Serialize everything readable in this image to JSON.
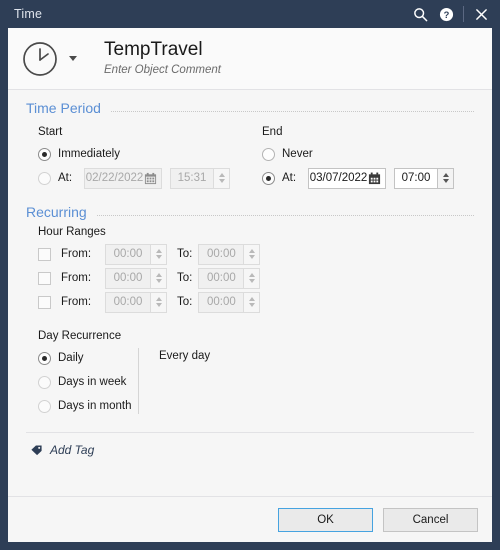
{
  "titlebar": {
    "title": "Time",
    "search_icon": "search-icon",
    "help_icon": "help-icon",
    "close_icon": "close-icon"
  },
  "object_header": {
    "icon": "clock-icon",
    "dropdown_icon": "chevron-down-icon",
    "title": "TempTravel",
    "subtitle": "Enter Object Comment"
  },
  "time_period": {
    "section_title": "Time Period",
    "start": {
      "label": "Start",
      "immediately_label": "Immediately",
      "immediately_selected": true,
      "at_label": "At:",
      "at_selected": false,
      "date_value": "02/22/2022",
      "time_value": "15:31",
      "calendar_icon": "calendar-icon",
      "enabled": false
    },
    "end": {
      "label": "End",
      "never_label": "Never",
      "never_selected": false,
      "at_label": "At:",
      "at_selected": true,
      "date_value": "03/07/2022",
      "time_value": "07:00",
      "calendar_icon": "calendar-icon",
      "enabled": true
    }
  },
  "recurring": {
    "section_title": "Recurring",
    "hour_ranges": {
      "label": "Hour Ranges",
      "from_label": "From:",
      "to_label": "To:",
      "rows": [
        {
          "checked": false,
          "from": "00:00",
          "to": "00:00"
        },
        {
          "checked": false,
          "from": "00:00",
          "to": "00:00"
        },
        {
          "checked": false,
          "from": "00:00",
          "to": "00:00"
        }
      ]
    },
    "day_recurrence": {
      "label": "Day Recurrence",
      "options": [
        {
          "label": "Daily",
          "selected": true
        },
        {
          "label": "Days in week",
          "selected": false
        },
        {
          "label": "Days in month",
          "selected": false
        }
      ],
      "description": "Every day"
    }
  },
  "tag": {
    "icon": "tag-icon",
    "label": "Add Tag"
  },
  "footer": {
    "ok_label": "OK",
    "cancel_label": "Cancel"
  },
  "colors": {
    "titlebar_bg": "#2e3e56",
    "section_title": "#5b8fd4",
    "primary_border": "#46a3e0",
    "body_bg": "#f6f6f6"
  }
}
